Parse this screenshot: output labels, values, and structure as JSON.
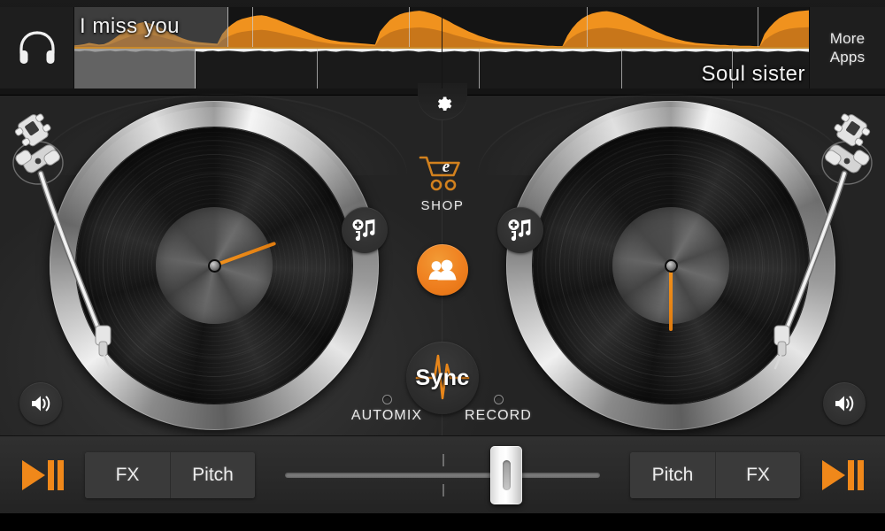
{
  "header": {
    "headphone_icon": "headphones-icon",
    "more_apps_line1": "More",
    "more_apps_line2": "Apps"
  },
  "waveforms": {
    "deck_a": {
      "track_title": "I miss you",
      "color": "#F0921E",
      "beat_marks_pct": [
        24.2,
        45.5,
        69.8,
        93.0
      ],
      "play_region_pct": 21,
      "peaks": [
        6,
        7,
        9,
        12,
        10,
        8,
        9,
        14,
        22,
        31,
        40,
        48,
        55,
        60,
        63,
        61,
        57,
        52,
        46,
        40,
        34,
        28,
        23,
        19,
        16,
        14,
        13,
        12,
        11,
        10,
        34,
        48,
        58,
        66,
        71,
        74,
        77,
        79,
        80,
        78,
        74,
        70,
        65,
        60,
        55,
        50,
        45,
        40,
        35,
        30,
        26,
        22,
        19,
        17,
        15,
        14,
        13,
        12,
        11,
        10,
        9,
        8,
        40,
        55,
        68,
        76,
        82,
        86,
        88,
        90,
        91,
        89,
        86,
        82,
        77,
        71,
        65,
        58,
        52,
        46,
        40,
        35,
        30,
        26,
        22,
        19,
        16,
        14,
        13,
        12,
        11,
        10,
        9,
        8,
        7,
        6,
        5,
        5,
        4,
        4,
        30,
        48,
        62,
        72,
        79,
        84,
        87,
        89,
        90,
        88,
        85,
        81,
        76,
        70,
        64,
        58,
        52,
        46,
        40,
        35,
        30,
        26,
        22,
        19,
        16,
        14,
        12,
        11,
        10,
        9,
        8,
        7,
        7,
        6,
        6,
        5,
        5,
        5,
        4,
        4,
        34,
        50,
        63,
        73,
        80,
        85,
        88,
        90,
        91,
        92
      ]
    },
    "deck_b": {
      "track_title": "Soul sister",
      "color": "#EFEFEF",
      "beat_marks_pct": [
        33.0,
        55.0,
        74.5,
        89.5
      ],
      "play_region_pct": 16.5,
      "peaks": [
        8,
        9,
        7,
        8,
        10,
        9,
        8,
        7,
        9,
        8,
        7,
        9,
        10,
        8,
        7,
        8,
        9,
        7,
        8,
        10,
        9,
        8,
        7,
        8,
        9,
        10,
        8,
        7,
        9,
        8,
        7,
        8,
        9,
        10,
        9,
        8,
        7,
        9,
        8,
        10,
        9,
        8,
        7,
        8,
        9,
        8,
        10,
        9,
        8,
        7,
        9,
        10,
        8,
        7,
        8,
        9,
        10,
        9,
        8,
        7,
        9,
        8,
        10,
        9,
        8,
        7,
        8,
        10,
        9,
        8,
        9,
        11,
        10,
        9,
        8,
        9,
        10,
        8,
        9,
        10,
        9,
        8,
        9,
        10,
        11,
        9,
        8,
        9,
        10,
        9,
        8,
        10,
        9,
        8,
        9,
        10,
        9,
        8,
        9,
        10,
        9,
        8,
        9,
        10,
        11,
        10,
        9,
        8,
        9,
        10,
        9,
        8,
        9,
        10,
        9,
        8,
        9,
        10,
        9,
        8,
        9,
        10,
        9,
        8,
        9,
        10,
        9,
        8,
        9,
        10,
        9,
        10,
        9,
        8,
        9,
        10,
        9,
        8,
        9,
        10,
        9,
        8,
        9,
        10
      ]
    },
    "playhead_pct": 50
  },
  "decks": {
    "left": {
      "add_music_icon": "add-music-icon",
      "volume_icon": "speaker-icon",
      "needle_angle_deg": 250
    },
    "right": {
      "add_music_icon": "add-music-icon",
      "volume_icon": "speaker-icon",
      "needle_angle_deg": 0
    }
  },
  "center": {
    "gear_icon": "gear-icon",
    "shop_icon": "shopping-cart-icon",
    "shop_label": "SHOP",
    "people_icon": "people-icon",
    "sync_label": "Sync",
    "sync_icon": "waveform-pulse-icon",
    "automix_label": "AUTOMIX",
    "automix_on": false,
    "record_label": "RECORD",
    "record_on": false
  },
  "bottom": {
    "left_play_icon": "play-pause-icon",
    "right_play_icon": "play-pause-icon",
    "left_buttons": [
      "FX",
      "Pitch"
    ],
    "right_buttons": [
      "Pitch",
      "FX"
    ],
    "crossfader": {
      "value_pct": 67
    }
  },
  "colors": {
    "accent_orange": "#F0881A",
    "panel_dark": "#2B2B2B",
    "bar_dark": "#1B1B1B",
    "text_light": "#ECECEC"
  }
}
